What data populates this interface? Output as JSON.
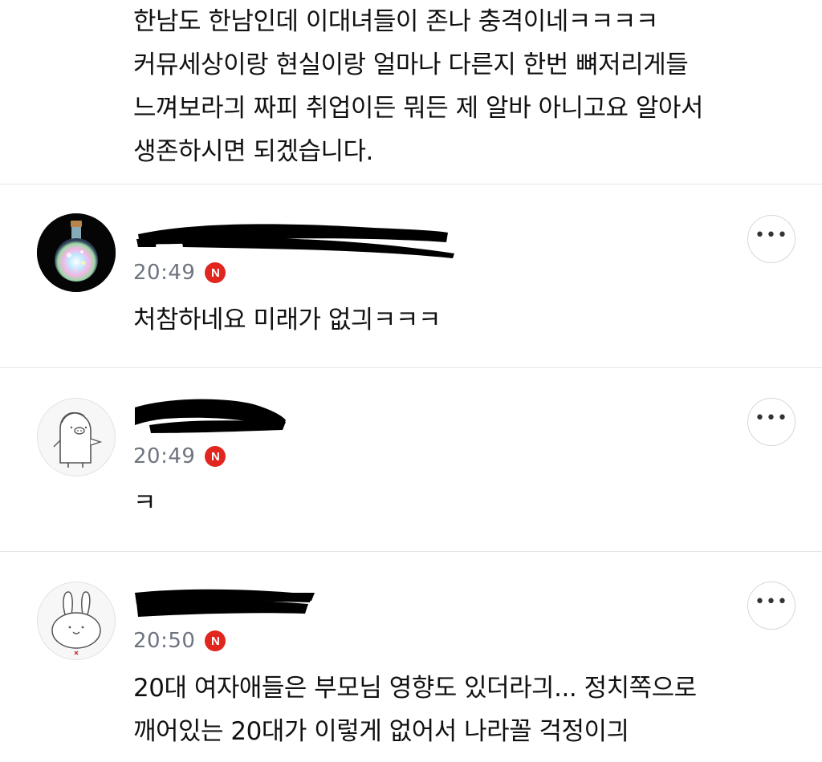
{
  "post": {
    "lines": [
      "한남도 한남인데 이대녀들이 존나 충격이네ㅋㅋㅋㅋ",
      "커뮤세상이랑 현실이랑 얼마나 다른지 한번 뼈저리게들",
      "느껴보라긔 짜피 취업이든 뭐든 제 알바 아니고요 알아서",
      "생존하시면 되겠습니다."
    ]
  },
  "comments": [
    {
      "avatar_icon": "glowing-flask-icon",
      "nickname_visible": "",
      "time": "20:49",
      "badge": "N",
      "more_label": "•••",
      "text_lines": [
        "처참하네요 미래가 없긔ㅋㅋㅋ"
      ]
    },
    {
      "avatar_icon": "pig-character-icon",
      "nickname_visible": "",
      "time": "20:49",
      "badge": "N",
      "more_label": "•••",
      "text_lines": [
        "ㅋ"
      ]
    },
    {
      "avatar_icon": "bunny-character-icon",
      "nickname_visible": "",
      "time": "20:50",
      "badge": "N",
      "more_label": "•••",
      "text_lines": [
        "20대 여자애들은 부모님 영향도 있더라긔...  정치쪽으로",
        "깨어있는 20대가 이렇게 없어서 나라꼴 걱정이긔"
      ]
    }
  ],
  "colors": {
    "badge": "#e0261f",
    "time": "#6e7480",
    "divider": "#e4e4e4"
  }
}
